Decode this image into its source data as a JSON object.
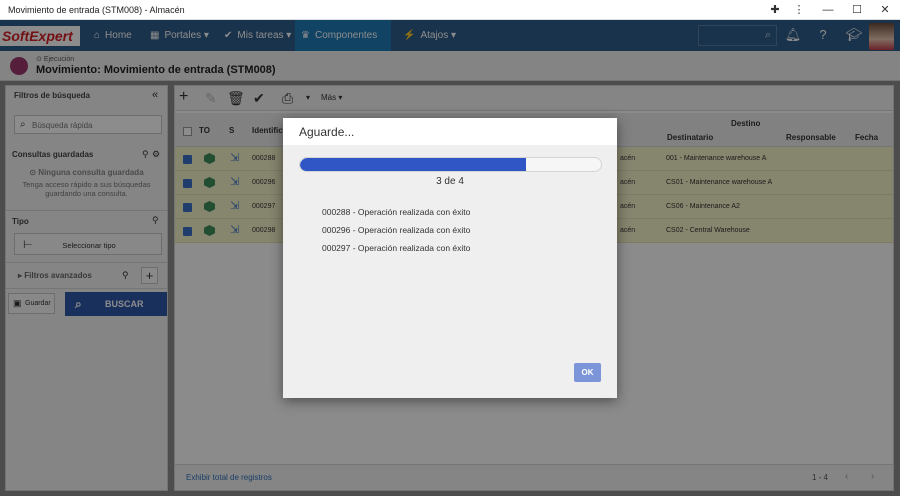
{
  "window": {
    "title": "Movimiento de entrada (STM008) - Almacén",
    "pin_icon": "puzzle-icon",
    "more_icon": "kebab-icon"
  },
  "nav": {
    "logo": "SoftExpert",
    "items": [
      {
        "label": "Home",
        "icon": "home-icon"
      },
      {
        "label": "Portales",
        "icon": "grid-icon",
        "caret": "▾"
      },
      {
        "label": "Mis tareas",
        "icon": "check-icon",
        "caret": "▾"
      },
      {
        "label": "Componentes",
        "icon": "trophy-icon",
        "caret": "▾",
        "active": true
      },
      {
        "label": "Atajos",
        "icon": "bolt-icon",
        "caret": "▾"
      }
    ]
  },
  "header": {
    "breadcrumb": "Ejecución",
    "title": "Movimiento: Movimiento de entrada (STM008)"
  },
  "left": {
    "filters_title": "Filtros de búsqueda",
    "quick_placeholder": "Búsqueda rápida",
    "saved_title": "Consultas guardadas",
    "no_saved": "Ninguna consulta guardada",
    "no_saved_hint1": "Tenga acceso rápido a sus búsquedas",
    "no_saved_hint2": "guardando una consulta.",
    "tipo_label": "Tipo",
    "select_tipo": "Seleccionar tipo",
    "advanced": "Filtros avanzados",
    "save": "Guardar",
    "search": "BUSCAR"
  },
  "grid": {
    "more": "Más",
    "columns": [
      "TO",
      "S",
      "Identificación"
    ],
    "group_header": "Destino",
    "dest_columns": [
      "Destinatario",
      "Responsable",
      "Fecha"
    ],
    "rows": [
      {
        "id": "000288",
        "status": "acén",
        "dest": "001 - Maintenance warehouse A"
      },
      {
        "id": "000296",
        "status": "acén",
        "dest": "CS01 - Maintenance warehouse A"
      },
      {
        "id": "000297",
        "status": "acén",
        "dest": "CS06 - Maintenance A2"
      },
      {
        "id": "000298",
        "status": "acén",
        "dest": "CS02 - Central Warehouse"
      }
    ],
    "footer_link": "Exhibir total de registros",
    "page_range": "1 - 4"
  },
  "modal": {
    "title": "Aguarde...",
    "progress_fraction": 0.75,
    "progress_text": "3 de 4",
    "messages": [
      "000288 - Operación realizada con éxito",
      "000296 - Operación realizada con éxito",
      "000297 - Operación realizada con éxito"
    ],
    "ok": "OK"
  },
  "colors": {
    "nav": "#2f5d8a",
    "active": "#1f7ab8",
    "progress": "#2f56c4",
    "row": "#f4f2c8",
    "ok": "#7b95d8"
  }
}
